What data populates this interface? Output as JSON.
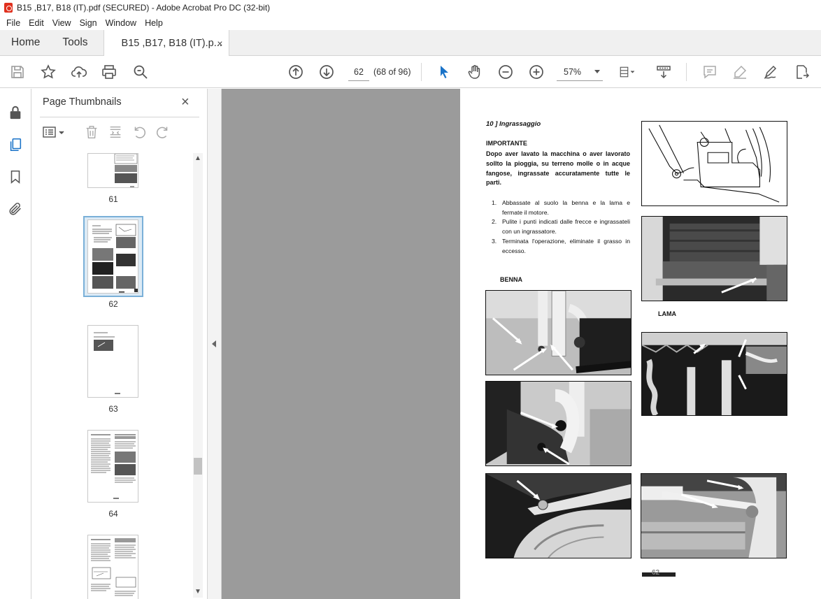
{
  "window": {
    "title": "B15 ,B17, B18 (IT).pdf (SECURED) - Adobe Acrobat Pro DC (32-bit)"
  },
  "menu": {
    "items": [
      "File",
      "Edit",
      "View",
      "Sign",
      "Window",
      "Help"
    ]
  },
  "tabs": {
    "home": "Home",
    "tools": "Tools",
    "document": "B15 ,B17, B18 (IT).p...",
    "close": "×"
  },
  "toolbar": {
    "page_current": "62",
    "page_of": "(68 of 96)",
    "zoom": "57%",
    "icons": [
      "save-icon",
      "star-icon",
      "upload-icon",
      "print-icon",
      "search-icon",
      "page-up-icon",
      "page-down-icon",
      "select-cursor-icon",
      "hand-icon",
      "zoom-out-icon",
      "zoom-in-icon",
      "fit-page-icon",
      "scroll-mode-icon",
      "comment-icon",
      "highlight-icon",
      "sign-icon",
      "share-icon"
    ]
  },
  "sidebar": {
    "icons": [
      "lock-icon",
      "pages-icon",
      "bookmark-icon",
      "attachment-icon"
    ]
  },
  "thumbnails_panel": {
    "title": "Page Thumbnails",
    "close": "×",
    "pages": [
      {
        "label": "61"
      },
      {
        "label": "62",
        "selected": true
      },
      {
        "label": "63"
      },
      {
        "label": "64"
      }
    ]
  },
  "document_page": {
    "section_title": "10 ] Ingrassaggio",
    "important_label": "IMPORTANTE",
    "important_text": "Dopo aver lavato la macchina o aver lavorato sollto la pioggia, su terreno molle o in acque fangose, ingrassate accuratamente tutte le parti.",
    "steps": [
      {
        "num": "1.",
        "text": "Abbassate al suolo la benna e la lama e fermate il motore."
      },
      {
        "num": "2.",
        "text": "Pulite i punti indicati dalle frecce e ingrassateli con un ingrassatore."
      },
      {
        "num": "3.",
        "text": "Terminata l'operazione, eliminate il grasso in eccesso."
      }
    ],
    "label_benna": "BENNA",
    "label_lama": "LAMA",
    "page_number": "62"
  },
  "colors": {
    "accent": "#1a73c8",
    "selection": "#dceaf5",
    "doc_bg": "#9b9b9b"
  }
}
